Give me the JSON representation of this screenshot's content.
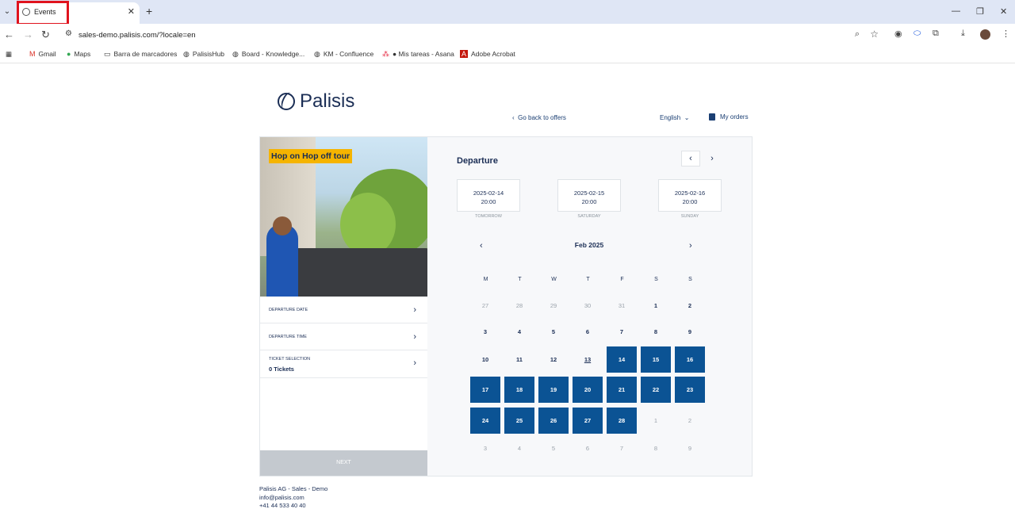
{
  "browser": {
    "tab_title": "Events",
    "url": "sales-demo.palisis.com/?locale=en",
    "bookmarks": [
      "Gmail",
      "Maps",
      "Barra de marcadores",
      "PalisisHub",
      "Board - Knowledge...",
      "KM - Confluence",
      "● Mis tareas - Asana",
      "Adobe Acrobat"
    ]
  },
  "header": {
    "logo_text": "Palisis",
    "back_link": "Go back to offers",
    "language": "English",
    "my_orders": "My orders"
  },
  "offer": {
    "title": "Hop on Hop off tour",
    "rows": [
      {
        "label": "DEPARTURE DATE",
        "value": ""
      },
      {
        "label": "DEPARTURE TIME",
        "value": ""
      },
      {
        "label": "TICKET SELECTION",
        "value": "0 Tickets"
      }
    ],
    "next_label": "NEXT"
  },
  "departure": {
    "title": "Departure",
    "quick_dates": [
      {
        "date": "2025-02-14",
        "time": "20:00",
        "sub": "TOMORROW"
      },
      {
        "date": "2025-02-15",
        "time": "20:00",
        "sub": "SATURDAY"
      },
      {
        "date": "2025-02-16",
        "time": "20:00",
        "sub": "SUNDAY"
      }
    ],
    "month": "Feb 2025",
    "weekdays": [
      "M",
      "T",
      "W",
      "T",
      "F",
      "S",
      "S"
    ],
    "days": [
      [
        "27",
        "28",
        "29",
        "30",
        "31",
        "1",
        "2"
      ],
      [
        "3",
        "4",
        "5",
        "6",
        "7",
        "8",
        "9"
      ],
      [
        "10",
        "11",
        "12",
        "13",
        "14",
        "15",
        "16"
      ],
      [
        "17",
        "18",
        "19",
        "20",
        "21",
        "22",
        "23"
      ],
      [
        "24",
        "25",
        "26",
        "27",
        "28",
        "1",
        "2"
      ],
      [
        "3",
        "4",
        "5",
        "6",
        "7",
        "8",
        "9"
      ]
    ]
  },
  "footer": {
    "company": "Palisis AG - Sales - Demo",
    "email": "info@palisis.com",
    "phone": "+41 44 533 40 40"
  }
}
